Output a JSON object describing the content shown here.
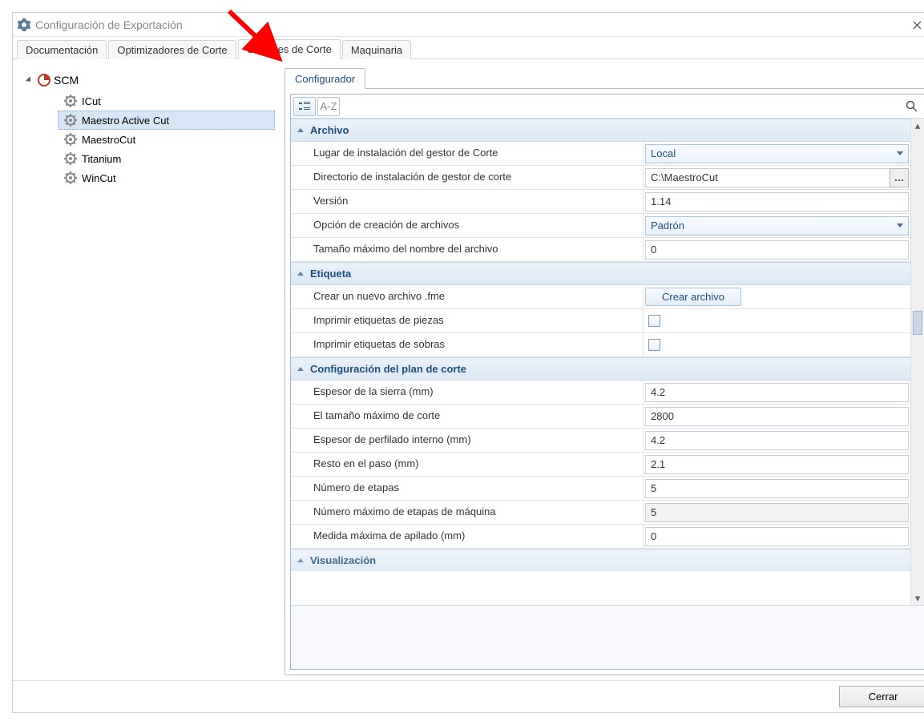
{
  "window": {
    "title": "Configuración de Exportación"
  },
  "mainTabs": {
    "t0": "Documentación",
    "t1": "Optimizadores de Corte",
    "t2": "Gestores de Corte",
    "t3": "Maquinaria"
  },
  "tree": {
    "root": "SCM",
    "items": {
      "i0": "ICut",
      "i1": "Maestro Active Cut",
      "i2": "MaestroCut",
      "i3": "Titanium",
      "i4": "WinCut"
    }
  },
  "innerTab": "Configurador",
  "toolbar": {
    "sort_label": "A-Z",
    "search_value": ""
  },
  "sections": {
    "archivo": {
      "title": "Archivo",
      "lugar_label": "Lugar de instalación del gestor de Corte",
      "lugar_value": "Local",
      "dir_label": "Directorio de instalación de gestor de corte",
      "dir_value": "C:\\MaestroCut",
      "version_label": "Versión",
      "version_value": "1.14",
      "opcion_label": "Opción de creación de archivos",
      "opcion_value": "Padrón",
      "tamano_label": "Tamaño máximo del nombre del archivo",
      "tamano_value": "0"
    },
    "etiqueta": {
      "title": "Etiqueta",
      "crear_label": "Crear un nuevo archivo .fme",
      "crear_btn": "Crear archivo",
      "imp_piezas_label": "Imprimir etiquetas de piezas",
      "imp_sobras_label": "Imprimir etiquetas de sobras"
    },
    "plan": {
      "title": "Configuración del plan de corte",
      "espesor_sierra_label": "Espesor de la sierra (mm)",
      "espesor_sierra_value": "4.2",
      "tam_max_label": "El tamaño máximo de corte",
      "tam_max_value": "2800",
      "espesor_perf_label": "Espesor de perfilado interno (mm)",
      "espesor_perf_value": "4.2",
      "resto_label": "Resto en el paso (mm)",
      "resto_value": "2.1",
      "num_etapas_label": "Número de etapas",
      "num_etapas_value": "5",
      "num_max_label": "Número máximo de etapas de máquina",
      "num_max_value": "5",
      "medida_label": "Medida máxima de apilado (mm)",
      "medida_value": "0"
    },
    "vis": {
      "title": "Visualización"
    }
  },
  "footer": {
    "close": "Cerrar"
  }
}
